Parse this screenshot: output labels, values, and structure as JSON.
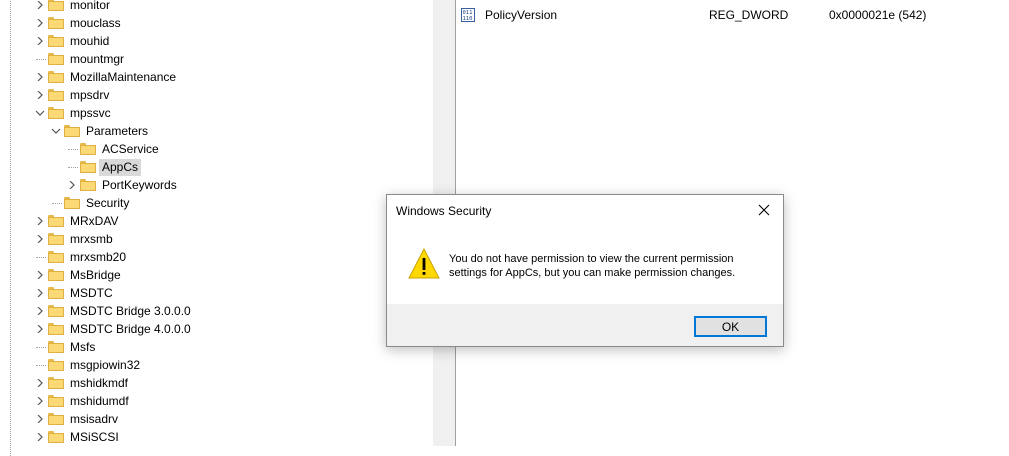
{
  "tree": {
    "items": [
      {
        "label": "monitor",
        "expander": "collapsed"
      },
      {
        "label": "mouclass",
        "expander": "collapsed"
      },
      {
        "label": "mouhid",
        "expander": "collapsed"
      },
      {
        "label": "mountmgr",
        "expander": "none"
      },
      {
        "label": "MozillaMaintenance",
        "expander": "collapsed"
      },
      {
        "label": "mpsdrv",
        "expander": "collapsed"
      },
      {
        "label": "mpssvc",
        "expander": "expanded"
      },
      {
        "label": "Parameters",
        "expander": "expanded"
      },
      {
        "label": "ACService",
        "expander": "none"
      },
      {
        "label": "AppCs",
        "expander": "none",
        "selected": true
      },
      {
        "label": "PortKeywords",
        "expander": "collapsed"
      },
      {
        "label": "Security",
        "expander": "none"
      },
      {
        "label": "MRxDAV",
        "expander": "collapsed"
      },
      {
        "label": "mrxsmb",
        "expander": "collapsed"
      },
      {
        "label": "mrxsmb20",
        "expander": "none"
      },
      {
        "label": "MsBridge",
        "expander": "collapsed"
      },
      {
        "label": "MSDTC",
        "expander": "collapsed"
      },
      {
        "label": "MSDTC Bridge 3.0.0.0",
        "expander": "collapsed"
      },
      {
        "label": "MSDTC Bridge 4.0.0.0",
        "expander": "collapsed"
      },
      {
        "label": "Msfs",
        "expander": "none"
      },
      {
        "label": "msgpiowin32",
        "expander": "none"
      },
      {
        "label": "mshidkmdf",
        "expander": "collapsed"
      },
      {
        "label": "mshidumdf",
        "expander": "collapsed"
      },
      {
        "label": "msisadrv",
        "expander": "collapsed"
      },
      {
        "label": "MSiSCSI",
        "expander": "collapsed"
      }
    ]
  },
  "values": {
    "rows": [
      {
        "name": "PolicyVersion",
        "type": "REG_DWORD",
        "data": "0x0000021e (542)",
        "icon": "dword-value-icon"
      }
    ]
  },
  "dialog": {
    "title": "Windows Security",
    "close_icon": "close-icon",
    "icon": "warning-icon",
    "message": "You do not have permission to view the current permission settings for AppCs, but you can make permission changes.",
    "ok_label": "OK"
  },
  "colors": {
    "accent": "#0078d7",
    "folder": "#fcd977",
    "warning": "#ffd800",
    "selection": "#d9d9d9"
  }
}
